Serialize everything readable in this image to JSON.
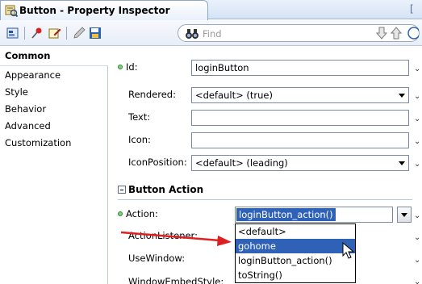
{
  "window": {
    "title": "Button - Property Inspector"
  },
  "toolbar": {
    "search_placeholder": "Find"
  },
  "sidebar": {
    "items": [
      {
        "label": "Common"
      },
      {
        "label": "Appearance"
      },
      {
        "label": "Style"
      },
      {
        "label": "Behavior"
      },
      {
        "label": "Advanced"
      },
      {
        "label": "Customization"
      }
    ]
  },
  "properties": {
    "id": {
      "label": "Id:",
      "value": "loginButton"
    },
    "rendered": {
      "label": "Rendered:",
      "value": "<default> (true)"
    },
    "text": {
      "label": "Text:",
      "value": ""
    },
    "icon": {
      "label": "Icon:",
      "value": ""
    },
    "icon_position": {
      "label": "IconPosition:",
      "value": "<default> (leading)"
    }
  },
  "button_action": {
    "section_title": "Button Action",
    "action": {
      "label": "Action:",
      "value": "loginButton_action()"
    },
    "action_listener": {
      "label": "ActionListener:"
    },
    "use_window": {
      "label": "UseWindow:"
    },
    "window_embed_style": {
      "label": "WindowEmbedStyle:"
    }
  },
  "dropdown": {
    "options": [
      "<default>",
      "gohome",
      "loginButton_action()",
      "toString()"
    ],
    "highlighted": "gohome"
  },
  "colors": {
    "selection": "#2f62b7",
    "annotation_arrow": "#e02020",
    "required_dot": "#7ccf7c"
  }
}
